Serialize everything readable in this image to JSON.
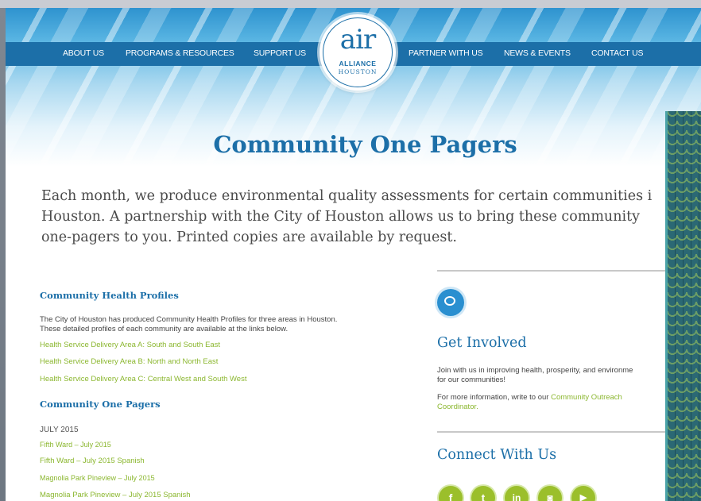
{
  "nav": {
    "left": [
      "ABOUT US",
      "PROGRAMS & RESOURCES",
      "SUPPORT US"
    ],
    "right": [
      "PARTNER WITH US",
      "NEWS & EVENTS",
      "CONTACT US"
    ]
  },
  "logo": {
    "air": "air",
    "alliance": "ALLIANCE",
    "houston": "HOUSTON"
  },
  "page_title": "Community One Pagers",
  "intro": {
    "line1": "Each month, we produce environmental quality assessments for certain communities i",
    "line2": "Houston. A partnership with the City of Houston allows us to bring these community",
    "line3": "one-pagers to you. Printed copies are available by request."
  },
  "health_profiles": {
    "heading": "Community Health Profiles",
    "text_line1": "The City of Houston has produced Community Health Profiles for three areas in Houston.",
    "text_line2": "These detailed profiles of each community are available at the links below.",
    "links": [
      "Health Service Delivery Area A: South and South East",
      "Health Service Delivery Area B: North and North East",
      "Health Service Delivery Area C: Central West and South West"
    ]
  },
  "one_pagers": {
    "heading": "Community One Pagers",
    "month": "JULY 2015",
    "links": [
      "Fifth Ward – July 2015",
      "Fifth Ward – July 2015 Spanish",
      "Magnolia Park Pineview – July 2015",
      "Magnolia Park Pineview – July 2015 Spanish"
    ]
  },
  "get_involved": {
    "title": "Get Involved",
    "text_line1": "Join with us in improving health, prosperity, and environme",
    "text_line2": "for our communities!",
    "more_prefix": "For more information, write to our ",
    "more_link_a": "Community Outreach",
    "more_link_b": "Coordinator."
  },
  "connect": {
    "title": "Connect With Us",
    "icons": [
      {
        "name": "facebook-icon",
        "glyph": "f"
      },
      {
        "name": "twitter-icon",
        "glyph": "t"
      },
      {
        "name": "linkedin-icon",
        "glyph": "in"
      },
      {
        "name": "instagram-icon",
        "glyph": "◙"
      },
      {
        "name": "youtube-icon",
        "glyph": "▶"
      }
    ]
  },
  "colors": {
    "brand_blue": "#1c6fa8",
    "link_green": "#8bb72f",
    "social_green": "#9bbf2b"
  }
}
